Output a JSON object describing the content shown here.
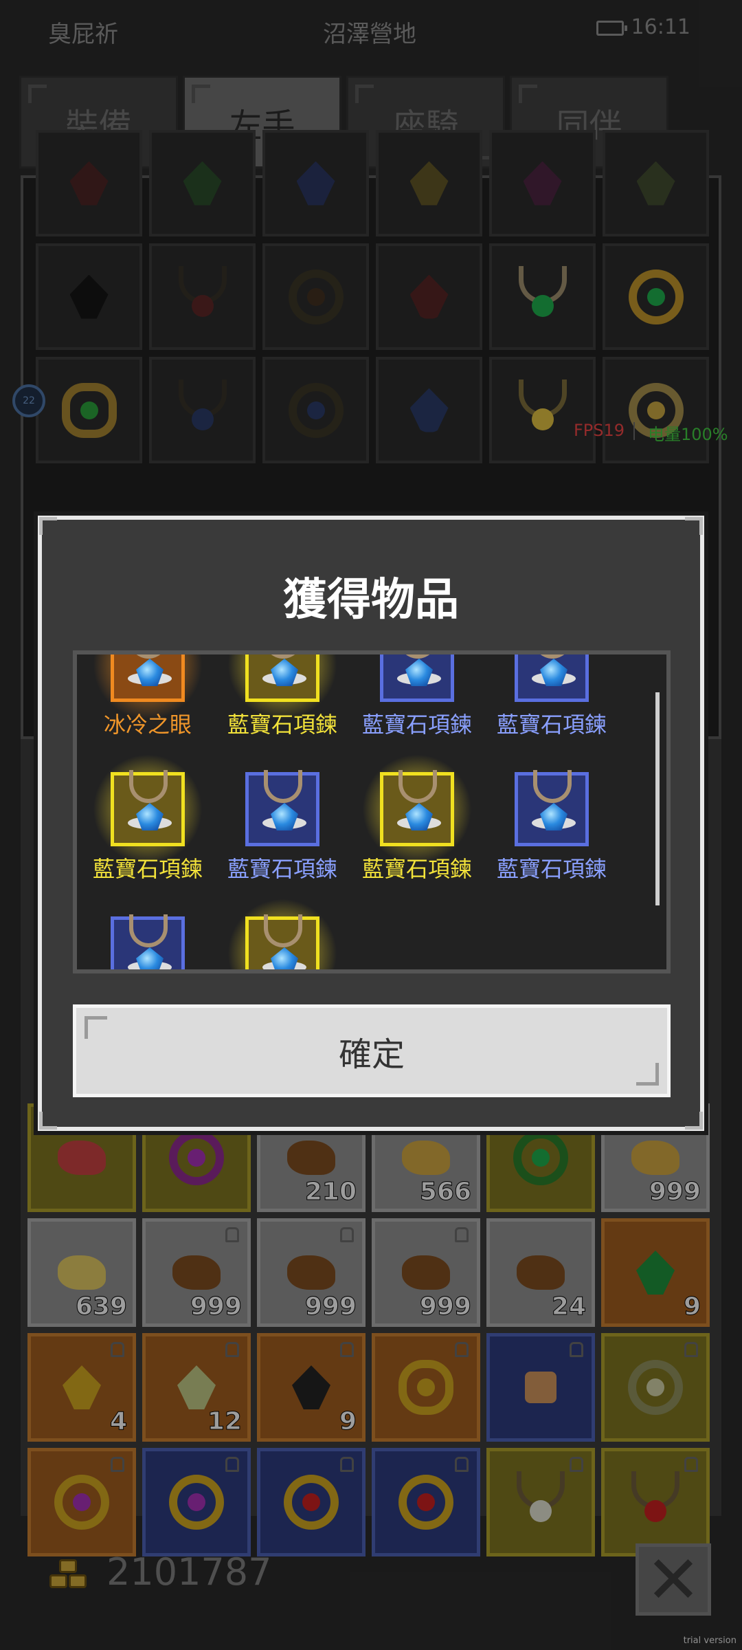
{
  "status_bar": {
    "player_name": "臭屁祈",
    "location": "沼澤營地",
    "time": "16:11"
  },
  "tabs": [
    {
      "label": "裝備"
    },
    {
      "label": "左手"
    },
    {
      "label": "座騎"
    },
    {
      "label": "同伴"
    }
  ],
  "active_tab": "左手",
  "hud": {
    "level_badge": "22",
    "fps": "FPS19",
    "battery": "电量100%"
  },
  "modal": {
    "title": "獲得物品",
    "confirm_label": "確定",
    "items": [
      {
        "name": "冰冷之眼",
        "rarity": "orange"
      },
      {
        "name": "藍寶石項鍊",
        "rarity": "yellow"
      },
      {
        "name": "藍寶石項鍊",
        "rarity": "blue"
      },
      {
        "name": "藍寶石項鍊",
        "rarity": "blue"
      },
      {
        "name": "藍寶石項鍊",
        "rarity": "yellow"
      },
      {
        "name": "藍寶石項鍊",
        "rarity": "blue"
      },
      {
        "name": "藍寶石項鍊",
        "rarity": "yellow"
      },
      {
        "name": "藍寶石項鍊",
        "rarity": "blue"
      },
      {
        "name": "",
        "rarity": "blue"
      },
      {
        "name": "",
        "rarity": "yellow"
      }
    ]
  },
  "inventory_counts": {
    "row1": [
      "",
      "",
      "210",
      "566",
      "",
      "999"
    ],
    "row2": [
      "639",
      "999",
      "999",
      "999",
      "24",
      "9"
    ],
    "row3": [
      "4",
      "12",
      "9",
      "",
      "",
      ""
    ]
  },
  "footer": {
    "gold": "2101787",
    "watermark": "trial version"
  },
  "colors": {
    "rarity_orange": "#f0962a",
    "rarity_yellow": "#f2e23a",
    "rarity_blue": "#8aa0ff",
    "fps_red": "#e34242",
    "battery_green": "#3fc23f"
  }
}
